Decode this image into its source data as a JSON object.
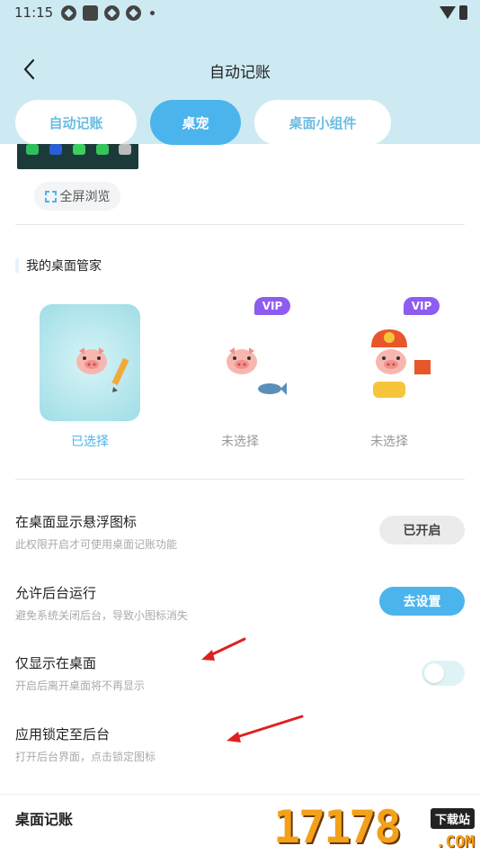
{
  "status_bar": {
    "time": "11:15"
  },
  "header": {
    "title": "自动记账"
  },
  "tabs": [
    {
      "label": "自动记账",
      "active": false
    },
    {
      "label": "桌宠",
      "active": true
    },
    {
      "label": "桌面小组件",
      "active": false
    }
  ],
  "preview": {
    "fullscreen_label": "全屏浏览"
  },
  "butler": {
    "title": "我的桌面管家",
    "pets": [
      {
        "label": "已选择",
        "selected": true,
        "vip": ""
      },
      {
        "label": "未选择",
        "selected": false,
        "vip": "VIP"
      },
      {
        "label": "未选择",
        "selected": false,
        "vip": "VIP"
      }
    ]
  },
  "settings": {
    "float_icon": {
      "title": "在桌面显示悬浮图标",
      "subtitle": "此权限开启才可使用桌面记账功能",
      "button": "已开启"
    },
    "background_run": {
      "title": "允许后台运行",
      "subtitle": "避免系统关闭后台，导致小图标消失",
      "button": "去设置"
    },
    "desktop_only": {
      "title": "仅显示在桌面",
      "subtitle": "开启后离开桌面将不再显示",
      "toggle_on": false
    },
    "lock_background": {
      "title": "应用锁定至后台",
      "subtitle": "打开后台界面，点击锁定图标"
    }
  },
  "bottom": {
    "title": "桌面记账"
  },
  "watermark": {
    "digits": "17178",
    "tag": "下载站",
    "domain": ".COM"
  },
  "colors": {
    "accent": "#4bb4ec",
    "header_bg": "#cdeaf3",
    "vip": "#8d5cf0",
    "arrow": "#e02020"
  }
}
